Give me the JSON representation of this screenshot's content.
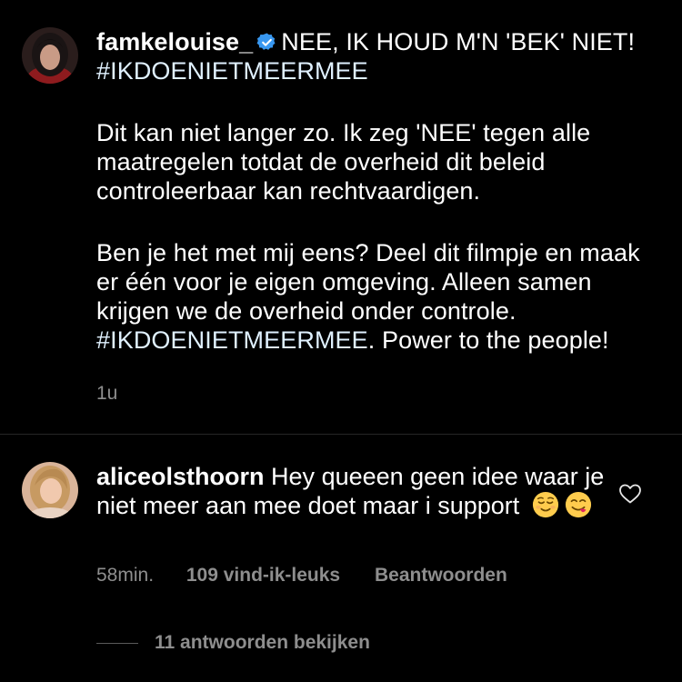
{
  "post": {
    "username": "famkelouise_",
    "verified_icon": "verified-badge-icon",
    "title_text": "NEE, IK HOUD M'N 'BEK' NIET!",
    "hashtag_line": "#IKDOENIETMEERMEE",
    "paragraph1": "Dit kan niet langer zo. Ik zeg 'NEE' tegen alle maatregelen totdat de overheid dit beleid controleerbaar kan rechtvaardigen.",
    "paragraph2_text": "Ben je het met mij eens? Deel dit filmpje en maak er één voor je eigen omgeving. Alleen samen krijgen we de overheid onder controle.",
    "paragraph2_hashtag": "#IKDOENIETMEERMEE",
    "paragraph2_tail": ". Power to the people!",
    "time": "1u"
  },
  "comment": {
    "username": "aliceolsthoorn",
    "text": "Hey queeen geen idee waar je niet meer aan mee doet maar i support",
    "emojis": [
      "relieved-face-emoji",
      "face-savoring-food-emoji"
    ],
    "time": "58min.",
    "likes": "109 vind-ik-leuks",
    "reply_label": "Beantwoorden",
    "view_replies": "11 antwoorden bekijken"
  },
  "colors": {
    "background": "#000000",
    "text": "#ffffff",
    "secondary": "#8e8e8e",
    "verified": "#3897f0",
    "hashtag": "#e0f1ff"
  }
}
